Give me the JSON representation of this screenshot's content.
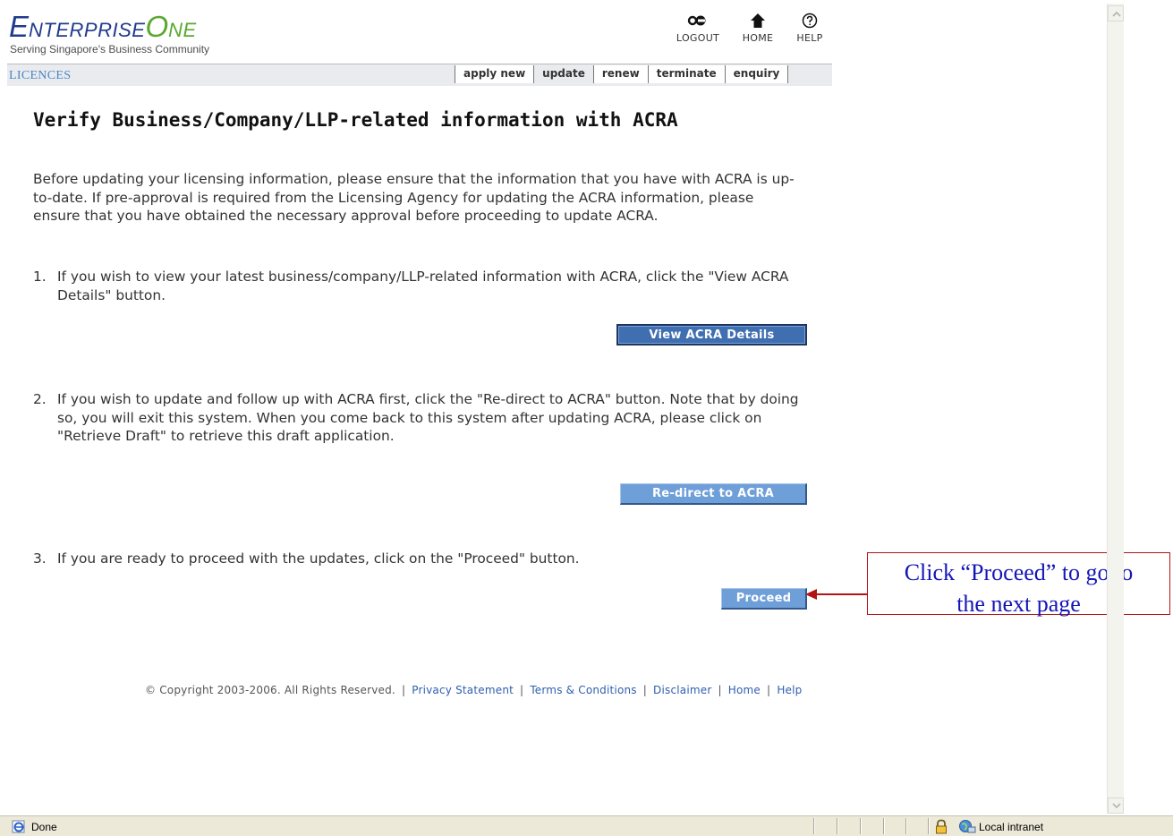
{
  "header": {
    "logo_cap_e": "E",
    "logo_rest_enterprise": "NTERPRISE",
    "logo_cap_o": "O",
    "logo_rest_one": "NE",
    "tagline": "Serving Singapore's Business Community",
    "logout_label": "LOGOUT",
    "home_label": "HOME",
    "help_label": "HELP",
    "section_label": "LICENCES"
  },
  "tabs": [
    {
      "label": "apply new"
    },
    {
      "label": "update"
    },
    {
      "label": "renew"
    },
    {
      "label": "terminate"
    },
    {
      "label": "enquiry"
    }
  ],
  "main": {
    "title": "Verify Business/Company/LLP-related information with ACRA",
    "intro": "Before updating your licensing information, please ensure that the information that you have with ACRA is up-to-date. If pre-approval is required from the Licensing Agency for updating the ACRA information, please ensure that you have obtained the necessary approval before proceeding to update ACRA.",
    "steps": [
      {
        "num": "1.",
        "text": "If you wish to view your latest business/company/LLP-related information with ACRA, click the \"View ACRA Details\" button.",
        "button": "View ACRA Details"
      },
      {
        "num": "2.",
        "text": "If you wish to update and follow up with ACRA first, click the \"Re-direct to ACRA\" button. Note that by doing so, you will exit this system. When you come back to this system after updating ACRA, please click on \"Retrieve Draft\" to retrieve this draft application.",
        "button": "Re-direct to ACRA"
      },
      {
        "num": "3.",
        "text": "If you are ready to proceed with the updates, click on the \"Proceed\" button.",
        "button": "Proceed"
      }
    ]
  },
  "footer": {
    "copyright": "© Copyright 2003-2006. All Rights Reserved.",
    "sep": "|",
    "links": [
      "Privacy Statement",
      "Terms & Conditions",
      "Disclaimer",
      "Home",
      "Help"
    ]
  },
  "callout": {
    "line1": "Click “Proceed” to go to",
    "line2": "the next page"
  },
  "statusbar": {
    "status": "Done",
    "zone": "Local intranet"
  },
  "colors": {
    "brand_blue": "#1f3b8c",
    "brand_green": "#5aa830",
    "button_blue": "#6f9fd9",
    "link": "#2f5fae",
    "callout_border": "#b01414",
    "callout_text": "#1515b8"
  }
}
